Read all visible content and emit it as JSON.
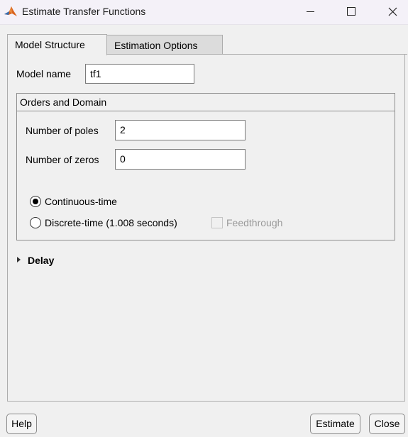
{
  "window": {
    "title": "Estimate Transfer Functions",
    "icon": "matlab-icon"
  },
  "tabs": [
    {
      "label": "Model Structure",
      "active": true
    },
    {
      "label": "Estimation Options",
      "active": false
    }
  ],
  "model_name": {
    "label": "Model name",
    "value": "tf1"
  },
  "orders_group": {
    "title": "Orders and Domain",
    "poles": {
      "label": "Number of poles",
      "value": "2"
    },
    "zeros": {
      "label": "Number of zeros",
      "value": "0"
    },
    "continuous": {
      "label": "Continuous-time",
      "selected": true
    },
    "discrete": {
      "label": "Discrete-time (1.008 seconds)",
      "selected": false
    },
    "feedthrough": {
      "label": "Feedthrough",
      "checked": false,
      "enabled": false
    }
  },
  "delay": {
    "label": "Delay",
    "expanded": false
  },
  "buttons": {
    "help": "Help",
    "estimate": "Estimate",
    "close": "Close"
  }
}
